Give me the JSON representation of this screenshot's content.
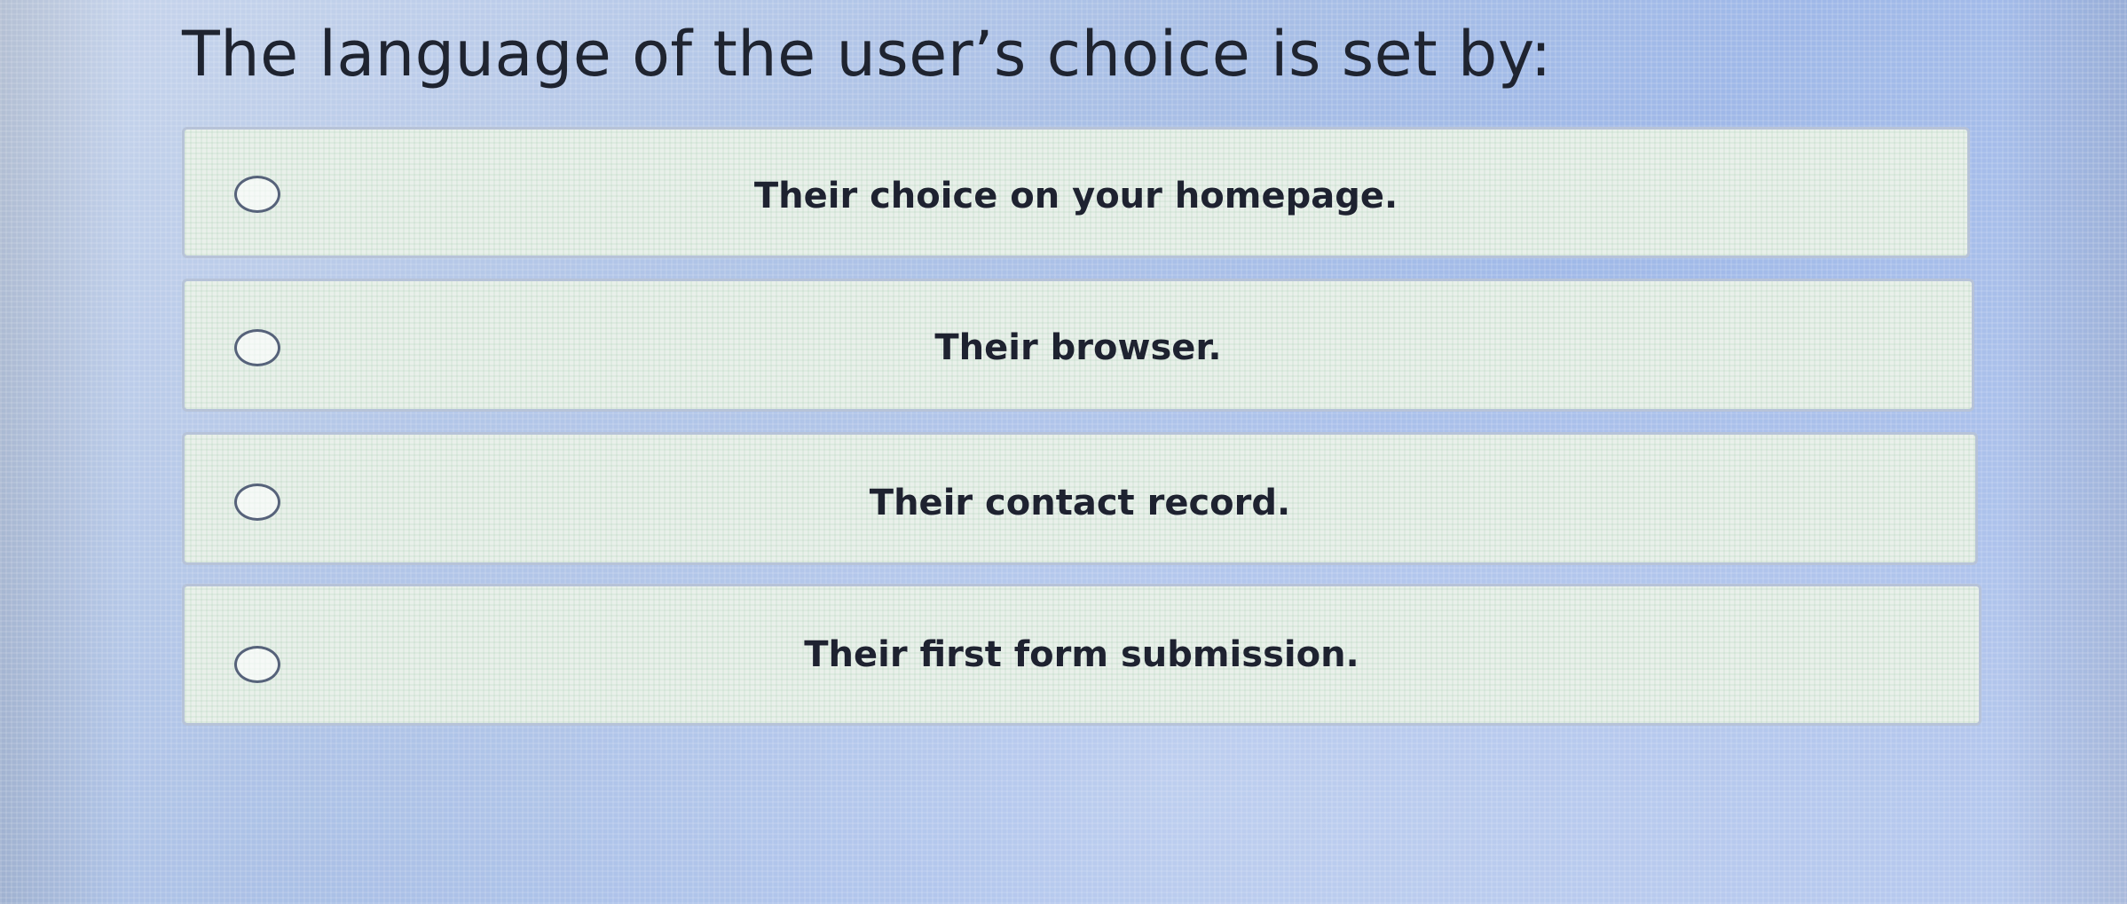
{
  "question": {
    "text": "The language of the user’s choice is set by:"
  },
  "options": [
    {
      "label": "Their choice on your homepage.",
      "selected": false
    },
    {
      "label": "Their browser.",
      "selected": false
    },
    {
      "label": "Their contact record.",
      "selected": false
    },
    {
      "label": "Their first form submission.",
      "selected": false
    }
  ],
  "colors": {
    "background": "#a9bfe6",
    "option_bg": "#e9f0ea",
    "option_border": "#b7c3d8",
    "text": "#1e2230"
  }
}
